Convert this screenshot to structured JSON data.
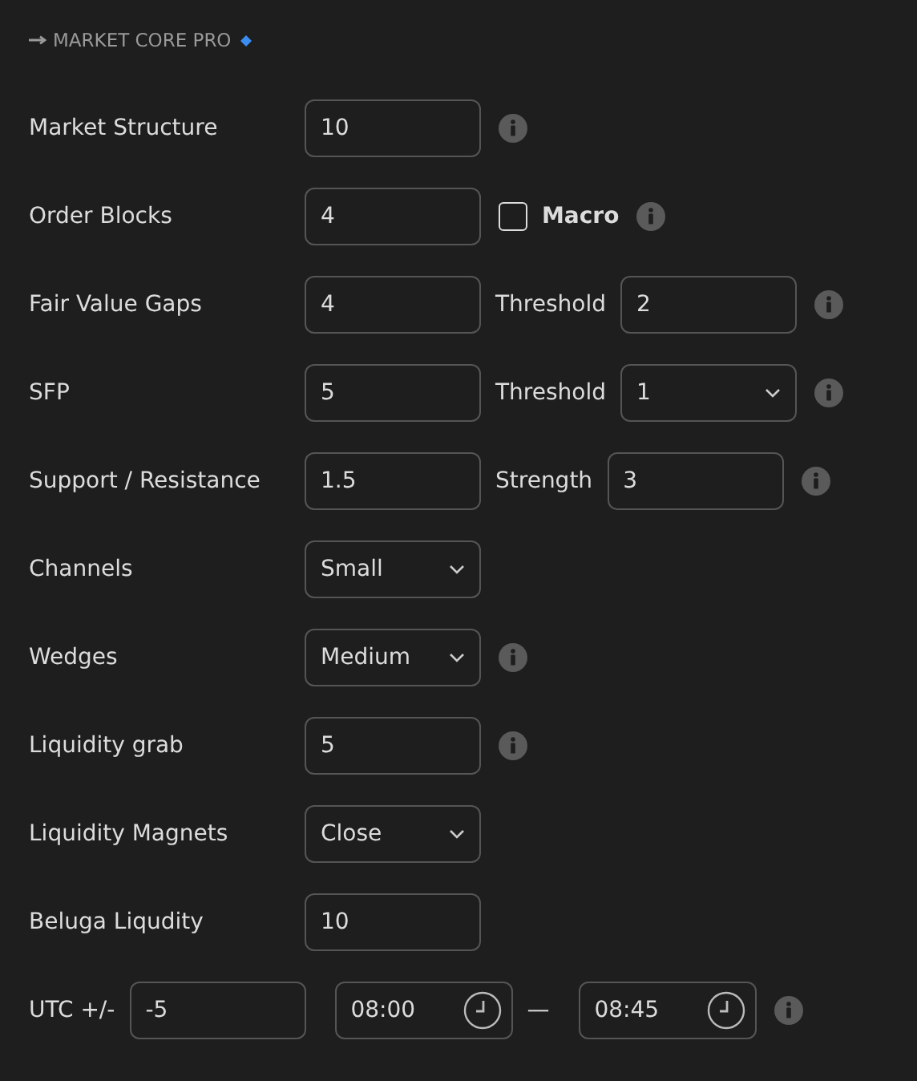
{
  "header": {
    "title": "MARKET CORE PRO"
  },
  "rows": [
    {
      "label": "Market Structure",
      "info": true,
      "controls": [
        {
          "kind": "input",
          "value": "10"
        }
      ]
    },
    {
      "label": "Order Blocks",
      "info": true,
      "controls": [
        {
          "kind": "input",
          "value": "4"
        },
        {
          "kind": "checkbox",
          "label": "Macro",
          "checked": false
        }
      ]
    },
    {
      "label": "Fair Value Gaps",
      "info": true,
      "controls": [
        {
          "kind": "input",
          "value": "4"
        },
        {
          "kind": "label",
          "text": "Threshold"
        },
        {
          "kind": "input",
          "value": "2"
        }
      ]
    },
    {
      "label": "SFP",
      "info": true,
      "controls": [
        {
          "kind": "input",
          "value": "5"
        },
        {
          "kind": "label",
          "text": "Threshold"
        },
        {
          "kind": "select",
          "value": "1"
        }
      ]
    },
    {
      "label": "Support / Resistance",
      "info": true,
      "controls": [
        {
          "kind": "input",
          "value": "1.5"
        },
        {
          "kind": "label",
          "text": "Strength"
        },
        {
          "kind": "input",
          "value": "3"
        }
      ]
    },
    {
      "label": "Channels",
      "info": false,
      "controls": [
        {
          "kind": "select",
          "value": "Small"
        }
      ]
    },
    {
      "label": "Wedges",
      "info": true,
      "controls": [
        {
          "kind": "select",
          "value": "Medium"
        }
      ]
    },
    {
      "label": "Liquidity grab",
      "info": true,
      "controls": [
        {
          "kind": "input",
          "value": "5"
        }
      ]
    },
    {
      "label": "Liquidity Magnets",
      "info": false,
      "controls": [
        {
          "kind": "select",
          "value": "Close"
        }
      ]
    },
    {
      "label": "Beluga Liqudity",
      "info": false,
      "controls": [
        {
          "kind": "input",
          "value": "10"
        }
      ]
    },
    {
      "info": true,
      "controls": [
        {
          "kind": "label",
          "text": "UTC +/-"
        },
        {
          "kind": "input",
          "value": "-5"
        },
        {
          "kind": "time",
          "value": "08:00"
        },
        {
          "kind": "dash",
          "text": "—"
        },
        {
          "kind": "time",
          "value": "08:45"
        }
      ]
    }
  ]
}
